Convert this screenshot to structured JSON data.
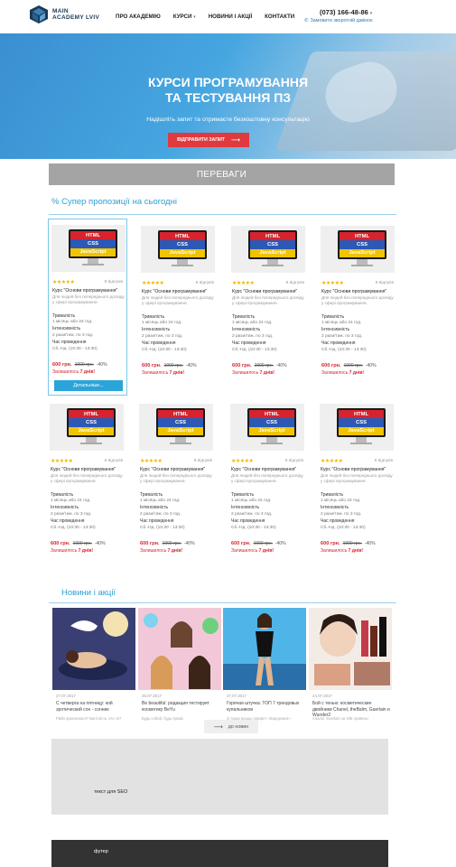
{
  "header": {
    "logo_line1": "MAIN",
    "logo_line2": "ACADEMY LVIV",
    "nav": [
      {
        "label": "ПРО АКАДЕМІЮ"
      },
      {
        "label": "КУРСИ"
      },
      {
        "label": "НОВИНИ І АКЦІЇ"
      },
      {
        "label": "КОНТАКТИ"
      }
    ],
    "phone": "(073) 166-48-86",
    "callback": "Замовити зворотній дзвінок"
  },
  "hero": {
    "title_line1": "КУРСИ ПРОГРАМУВАННЯ",
    "title_line2": "ТА ТЕСТУВАННЯ ПЗ",
    "subtitle": "Надішліть запит та отримаєте безкоштовну консультацію",
    "button": "ВІДПРАВИТИ ЗАПИТ"
  },
  "advantages": {
    "label": "ПЕРЕВАГИ"
  },
  "offers": {
    "title": "% Супер пропозиції на сьогодні",
    "card": {
      "tech": [
        "HTML",
        "CSS",
        "JavaScript"
      ],
      "rating": 5,
      "stars": "★★★★★",
      "rating_label": "8 відгуків",
      "title": "Курс \"Основи програмування\"",
      "desc": "Для людей без попереднього досвіду у сфері програмування.",
      "duration_label": "Тривалість",
      "duration_value": "1 місяць або 24 год.",
      "intensity_label": "Інтенсивність",
      "intensity_value": "2 рази/тиж. по 3 год.",
      "time_label": "Час проведення",
      "time_value": "Сб.-Нд. (10:30 - 13:30)",
      "price_new": "600 грн.",
      "price_old": "1000 грн.",
      "discount": "-40%",
      "left_prefix": "Залишилось",
      "left_days": "7 днів!",
      "details": "Детальніше..."
    }
  },
  "news": {
    "title": "Новини і акції",
    "items": [
      {
        "date": "27.07.2017",
        "title": "С четверга на пятницу: кой эротический сон - сонник",
        "sub": "Риба приснилася? Вагітність, кто ти?"
      },
      {
        "date": "26.07.2017",
        "title": "Be beautiful: редакция тестирует косметику BeYu",
        "sub": "Будь собой, будь яркой."
      },
      {
        "date": "27.07.2017",
        "title": "Горячая штучка: ТОП 7 трендовых купальников",
        "sub": "О таких вещах говорят «Бидорожні»."
      },
      {
        "date": "24.07.2017",
        "title": "Бой с тенью: косметические двойники Chanel, theBalm, Guerlain и Wunder2",
        "sub": "Аналог Guerlain за 195 гривень!"
      }
    ],
    "all": "до новин"
  },
  "seo": {
    "text": "текст для SEO"
  },
  "footer": {
    "text": "футер"
  },
  "colors": {
    "accent": "#2aa0d6",
    "cta": "#e0393e",
    "price": "#d6232d"
  }
}
